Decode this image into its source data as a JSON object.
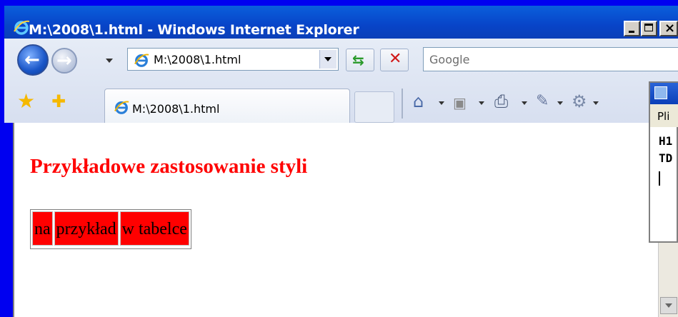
{
  "window": {
    "title": "M:\\2008\\1.html - Windows Internet Explorer",
    "controls": [
      "minimize",
      "maximize",
      "close"
    ]
  },
  "toolbar": {
    "address": "M:\\2008\\1.html",
    "search_placeholder": "Google",
    "icons": [
      "back-icon",
      "forward-icon",
      "refresh-icon",
      "stop-icon",
      "home-icon",
      "feeds-icon",
      "print-icon",
      "page-icon",
      "tools-icon"
    ]
  },
  "tab": {
    "label": "M:\\2008\\1.html"
  },
  "page": {
    "heading": "Przykładowe zastosowanie styli",
    "table_cells": [
      "na",
      "przykład",
      "w tabelce"
    ],
    "heading_color": "#ff0000",
    "cell_bg": "#ff0000"
  },
  "side_window": {
    "menu_label": "Pli",
    "lines": [
      "H1",
      "TD"
    ]
  }
}
